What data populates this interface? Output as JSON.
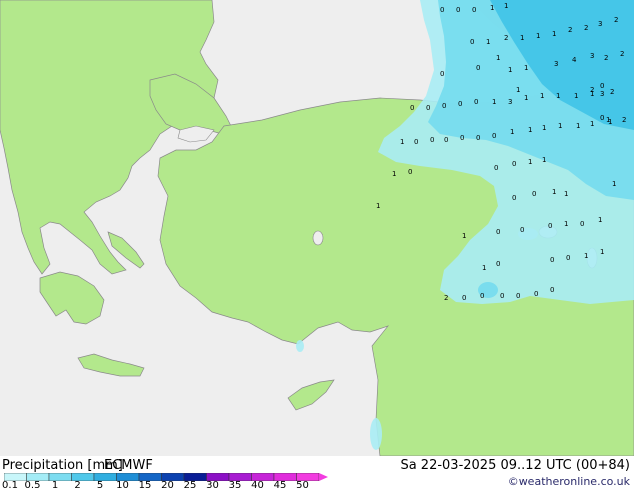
{
  "header": {
    "title": "Precipitation [mm]",
    "model": "ECMWF",
    "datetime": "Sa 22-03-2025 09..12 UTC (00+84)",
    "credit": "©weatheronline.co.uk"
  },
  "colors": {
    "sea": "#eeeeee",
    "land": "#b3e88c",
    "coast": "#8a8a8a",
    "precip_light": "#a8ecf4",
    "precip_mid": "#74dcee",
    "precip_heavy": "#3cc2e6"
  },
  "legend": {
    "ticks": [
      "0.1",
      "0.5",
      "1",
      "2",
      "5",
      "10",
      "15",
      "20",
      "25",
      "30",
      "35",
      "40",
      "45",
      "50"
    ],
    "colors": [
      "#c8f6fa",
      "#a4ecf6",
      "#7cdcf0",
      "#50c8ea",
      "#30aee0",
      "#1e8ed6",
      "#1466c6",
      "#0c42b0",
      "#0a1e96",
      "#8c10c6",
      "#a81cd2",
      "#c624d8",
      "#e02cdc",
      "#f23ce0"
    ]
  },
  "labels": [
    {
      "t": "0"
    },
    {
      "t": "0"
    },
    {
      "t": "0"
    },
    {
      "t": "1"
    },
    {
      "t": "1"
    },
    {
      "t": "0"
    },
    {
      "t": "1"
    },
    {
      "t": "2"
    },
    {
      "t": "1"
    },
    {
      "t": "1"
    },
    {
      "t": "1"
    },
    {
      "t": "2"
    },
    {
      "t": "2"
    },
    {
      "t": "3"
    },
    {
      "t": "2"
    },
    {
      "t": "0"
    },
    {
      "t": "1"
    },
    {
      "t": "1"
    },
    {
      "t": "3"
    },
    {
      "t": "4"
    },
    {
      "t": "3"
    },
    {
      "t": "2"
    },
    {
      "t": "2"
    },
    {
      "t": "0"
    },
    {
      "t": "1"
    },
    {
      "t": "1"
    },
    {
      "t": "3"
    },
    {
      "t": "2"
    },
    {
      "t": "2"
    },
    {
      "t": "0"
    },
    {
      "t": "0"
    },
    {
      "t": "0"
    },
    {
      "t": "0"
    },
    {
      "t": "0"
    },
    {
      "t": "1"
    },
    {
      "t": "3"
    },
    {
      "t": "1"
    },
    {
      "t": "1"
    },
    {
      "t": "1"
    },
    {
      "t": "1"
    },
    {
      "t": "1"
    },
    {
      "t": "1"
    },
    {
      "t": "2"
    },
    {
      "t": "1"
    },
    {
      "t": "0"
    },
    {
      "t": "0"
    },
    {
      "t": "0"
    },
    {
      "t": "0"
    },
    {
      "t": "0"
    },
    {
      "t": "0"
    },
    {
      "t": "1"
    },
    {
      "t": "1"
    },
    {
      "t": "1"
    },
    {
      "t": "1"
    },
    {
      "t": "1"
    },
    {
      "t": "1"
    },
    {
      "t": "1"
    },
    {
      "t": "1"
    },
    {
      "t": "0"
    },
    {
      "t": "0"
    },
    {
      "t": "0"
    },
    {
      "t": "1"
    },
    {
      "t": "1"
    },
    {
      "t": "1"
    },
    {
      "t": "0"
    },
    {
      "t": "0"
    },
    {
      "t": "1"
    },
    {
      "t": "1"
    },
    {
      "t": "1"
    },
    {
      "t": "0"
    },
    {
      "t": "0"
    },
    {
      "t": "0"
    },
    {
      "t": "1"
    },
    {
      "t": "0"
    },
    {
      "t": "1"
    },
    {
      "t": "1"
    },
    {
      "t": "0"
    },
    {
      "t": "0"
    },
    {
      "t": "0"
    },
    {
      "t": "1"
    },
    {
      "t": "1"
    },
    {
      "t": "1"
    },
    {
      "t": "2"
    },
    {
      "t": "0"
    },
    {
      "t": "0"
    },
    {
      "t": "0"
    },
    {
      "t": "0"
    },
    {
      "t": "0"
    },
    {
      "t": "0"
    },
    {
      "t": "0"
    },
    {
      "t": "0"
    },
    {
      "t": "0"
    }
  ]
}
